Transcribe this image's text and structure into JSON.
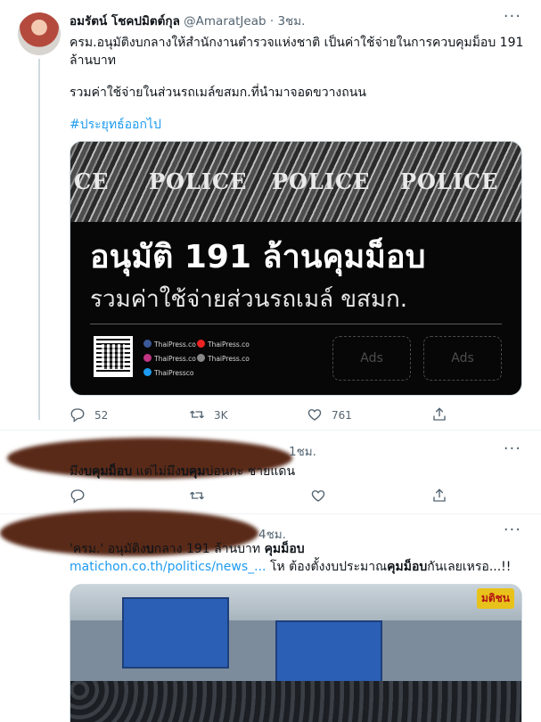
{
  "tweet1": {
    "display_name": "อมรัตน์ โชคปมิตต์กุล",
    "handle": "@AmaratJeab",
    "separator": "·",
    "time": "3ชม.",
    "more": "···",
    "line1": "ครม.อนุมัติงบกลางให้สำนักงานตำรวจแห่งชาติ เป็นค่าใช้จ่ายในการควบคุมม็อบ 191",
    "line2": "ล้านบาท",
    "line3": "รวมค่าใช้จ่ายในส่วนรถเมล์ขสมก.ที่นำมาจอดขวางถนน",
    "hashtag": "#ประยุทธ์ออกไป",
    "card": {
      "police_words": [
        "CE",
        "POLICE",
        "POLICE",
        "POLICE"
      ],
      "headline": "อนุมัติ 191 ล้านคุมม็อบ",
      "subline": "รวมค่าใช้จ่ายส่วนรถเมล์ ขสมก.",
      "social": [
        "ThaiPress.co",
        "ThaiPress.co",
        "ThaiPress.co",
        "ThaiPress.co",
        "ThaiPressco"
      ],
      "ads": [
        "Ads",
        "Ads"
      ]
    },
    "actions": {
      "reply": "52",
      "retweet": "3K",
      "like": "761",
      "share": ""
    }
  },
  "tweet2": {
    "time": "1ชม.",
    "more": "···",
    "text_parts": [
      "มึง",
      "บคุมม็อบ",
      " แต่ไม่มึง",
      "บคุม",
      "บ่อนกะ ชายแดน"
    ],
    "actions": {
      "reply": "",
      "retweet": "",
      "like": "",
      "share": ""
    }
  },
  "tweet3": {
    "time": "4ชม.",
    "more": "···",
    "line1_parts": [
      "'ครม.' อนุมัติง",
      "บ",
      "กลาง 191 ล้านบาท ",
      "คุมม็อบ"
    ],
    "link": "matichon.co.th/politics/news_...",
    "line2_parts": [
      " โห ต้องตั้งงบประมาณ",
      "คุมม็อบ",
      "กันเลยเหรอ...!!"
    ],
    "photo_logo": "มติชน"
  },
  "colors": {
    "accent": "#1d9bf0",
    "muted": "#536471",
    "scribble": "#5a2a18"
  }
}
